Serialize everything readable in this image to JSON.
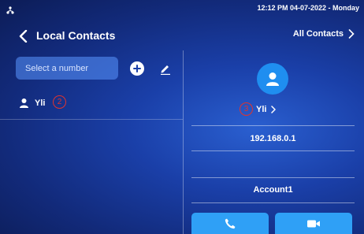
{
  "status_bar": {
    "time": "12:12 PM 04-07-2022 - Monday"
  },
  "header": {
    "title": "Local Contacts",
    "all_contacts_label": "All Contacts"
  },
  "search": {
    "placeholder": "Select a number"
  },
  "contacts": [
    {
      "name": "Yli"
    }
  ],
  "annotations": {
    "left": "2",
    "right": "3"
  },
  "detail": {
    "name": "Yli",
    "ip": "192.168.0.1",
    "account": "Account1"
  },
  "colors": {
    "accent": "#2fa0f6",
    "avatar": "#1f8ef0",
    "annotation": "#e0332e"
  }
}
